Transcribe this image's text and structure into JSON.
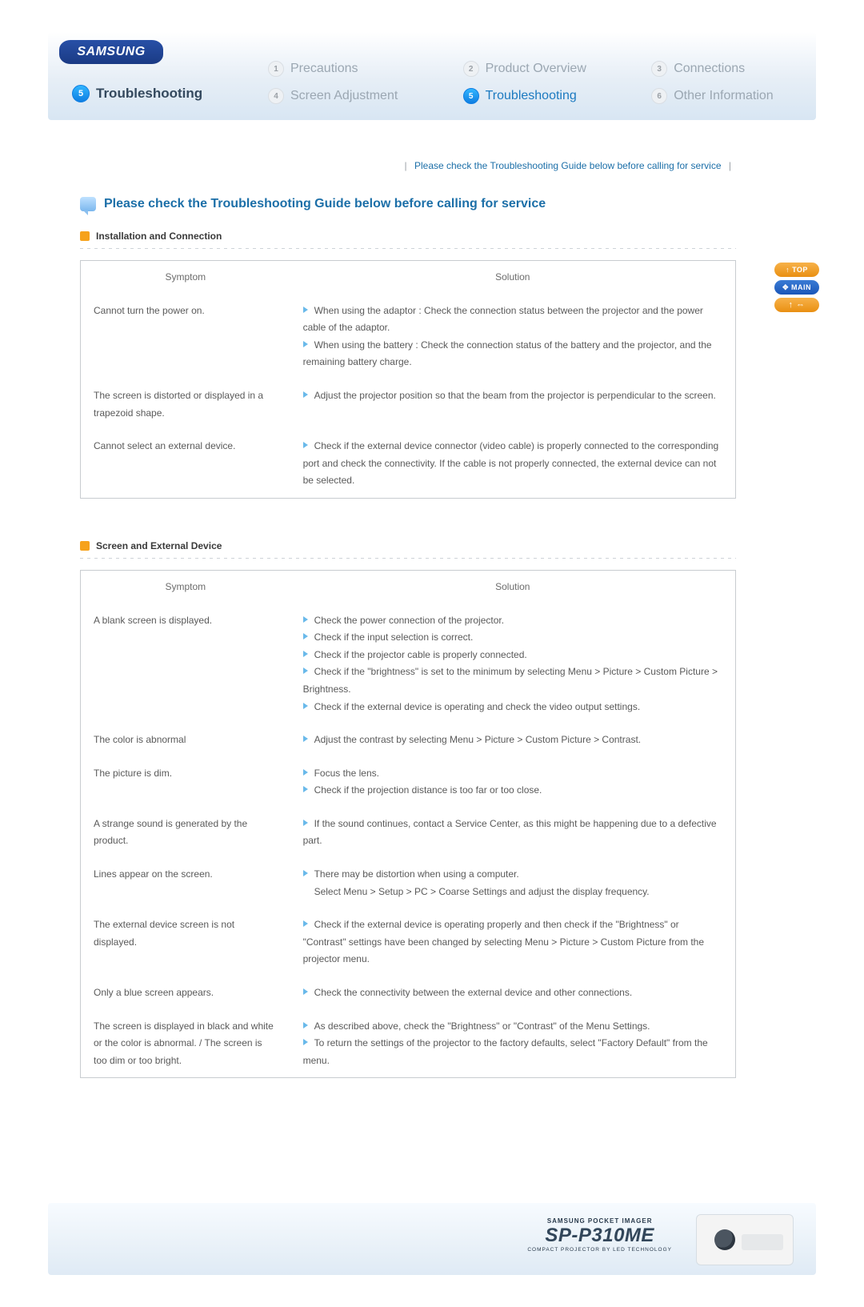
{
  "brand": "SAMSUNG",
  "crumb": {
    "num": "5",
    "label": "Troubleshooting"
  },
  "nav": [
    {
      "num": "1",
      "label": "Precautions",
      "active": false
    },
    {
      "num": "2",
      "label": "Product Overview",
      "active": false
    },
    {
      "num": "3",
      "label": "Connections",
      "active": false
    },
    {
      "num": "4",
      "label": "Screen Adjustment",
      "active": false
    },
    {
      "num": "5",
      "label": "Troubleshooting",
      "active": true
    },
    {
      "num": "6",
      "label": "Other Information",
      "active": false
    }
  ],
  "toplink": "Please check the Troubleshooting Guide below before calling for service",
  "section_title": "Please check the Troubleshooting Guide below before calling for service",
  "side": {
    "top": "↑ TOP",
    "main": "✥ MAIN",
    "idx": "↑ ⇔"
  },
  "sections": [
    {
      "heading": "Installation and Connection",
      "cols": {
        "symptom": "Symptom",
        "solution": "Solution"
      },
      "rows": [
        {
          "symptom": "Cannot turn the power on.",
          "solutions": [
            "When using the adaptor : Check the connection status between the projector and the power cable of the adaptor.",
            "When using the battery : Check the connection status of the battery and the projector, and the remaining battery charge."
          ]
        },
        {
          "symptom": "The screen is distorted or displayed in a trapezoid shape.",
          "solutions": [
            "Adjust the projector position so that the beam from the projector is perpendicular to the screen."
          ]
        },
        {
          "symptom": "Cannot select an external device.",
          "solutions": [
            "Check if the external device connector (video cable) is properly connected to the corresponding port and check the connectivity. If the cable is not properly connected, the external device can not be selected."
          ]
        }
      ]
    },
    {
      "heading": "Screen and External Device",
      "cols": {
        "symptom": "Symptom",
        "solution": "Solution"
      },
      "rows": [
        {
          "symptom": "A blank screen is displayed.",
          "solutions": [
            "Check the power connection of the projector.",
            "Check if the input selection is correct.",
            "Check if the projector cable is properly connected.",
            "Check if the \"brightness\" is set to the minimum by selecting Menu > Picture > Custom Picture > Brightness.",
            "Check if the external device is operating and check the video output settings."
          ]
        },
        {
          "symptom": "The color is abnormal",
          "solutions": [
            "Adjust the contrast by selecting Menu > Picture > Custom Picture > Contrast."
          ]
        },
        {
          "symptom": "The picture is dim.",
          "solutions": [
            "Focus the lens.",
            "Check if the projection distance is too far or too close."
          ]
        },
        {
          "symptom": "A strange sound is generated by the product.",
          "solutions": [
            "If the sound continues, contact a Service Center, as this might be happening due to a defective part."
          ]
        },
        {
          "symptom": "Lines appear on the screen.",
          "solutions": [
            "There may be distortion when using a computer.\nSelect Menu > Setup > PC > Coarse Settings and adjust the display frequency."
          ]
        },
        {
          "symptom": "The external device screen is not displayed.",
          "solutions": [
            "Check if the external device is operating properly and then check if the \"Brightness\" or \"Contrast\" settings have been changed by selecting Menu > Picture > Custom Picture from the projector menu."
          ]
        },
        {
          "symptom": "Only a blue screen appears.",
          "solutions": [
            "Check the connectivity between the external device and other connections."
          ]
        },
        {
          "symptom": "The screen is displayed in black and white or the color is abnormal. / The screen is too dim or too bright.",
          "solutions": [
            "As described above, check the \"Brightness\" or \"Contrast\" of the Menu Settings.",
            "To return the settings of the projector to the factory defaults, select \"Factory Default\" from the menu."
          ]
        }
      ]
    }
  ],
  "footer": {
    "top": "SAMSUNG POCKET IMAGER",
    "model": "SP-P310ME",
    "sub": "COMPACT PROJECTOR BY LED TECHNOLOGY"
  }
}
